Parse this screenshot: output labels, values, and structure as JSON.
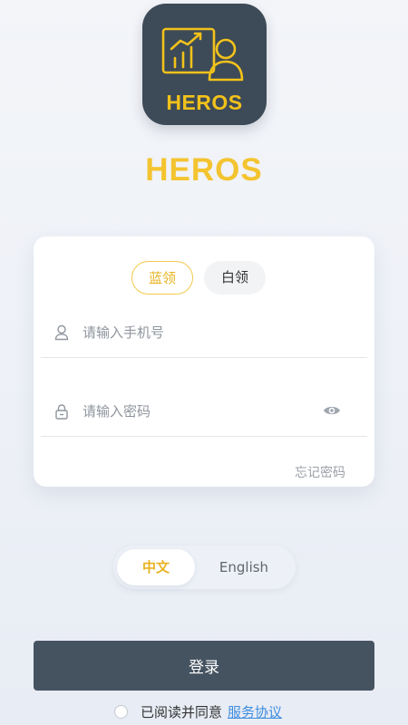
{
  "app": {
    "logo_text": "HEROS",
    "title": "HEROS"
  },
  "role_tabs": {
    "active": "蓝领",
    "inactive": "白领"
  },
  "phone_field": {
    "placeholder": "请输入手机号",
    "value": ""
  },
  "password_field": {
    "placeholder": "请输入密码",
    "value": ""
  },
  "forgot_password": "忘记密码",
  "language": {
    "options": [
      "中文",
      "English"
    ],
    "selected": "中文"
  },
  "login_button": "登录",
  "agreement": {
    "text": "已阅读并同意",
    "link": "服务协议",
    "checked": false
  },
  "icons": {
    "phone": "user-icon",
    "password": "lock-icon",
    "toggle_visibility": "eye-icon",
    "logo": "chart-presenter-icon"
  },
  "colors": {
    "brand_yellow": "#f4c430",
    "logo_bg": "#3d4a57",
    "login_button": "#455361",
    "link": "#3d8de0"
  }
}
